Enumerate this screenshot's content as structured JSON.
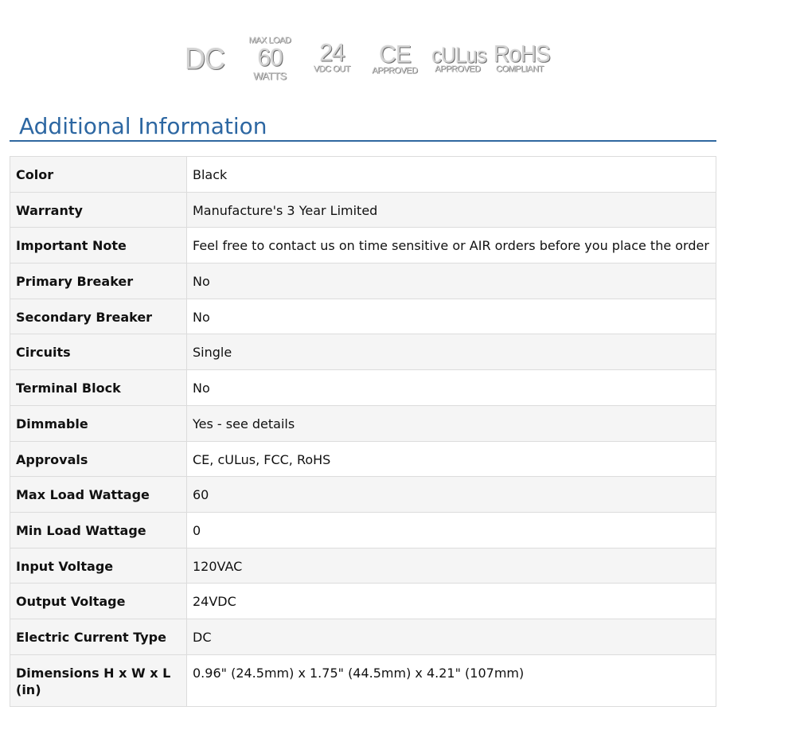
{
  "badges": {
    "dc": "DC",
    "max_load_top": "MAX LOAD",
    "max_load_value": "60",
    "max_load_unit": "WATTS",
    "vdc_value": "24",
    "vdc_label": "VDC OUT",
    "ce": "CE",
    "ce_label": "APPROVED",
    "culus": "cULus",
    "culus_label": "APPROVED",
    "rohs": "RoHS",
    "rohs_label": "COMPLIANT"
  },
  "section": {
    "title": "Additional Information"
  },
  "specs": [
    {
      "label": "Color",
      "value": "Black"
    },
    {
      "label": "Warranty",
      "value": "Manufacture's 3 Year Limited"
    },
    {
      "label": "Important Note",
      "value": "Feel free to contact us on time sensitive or AIR orders before you place the order"
    },
    {
      "label": "Primary Breaker",
      "value": "No"
    },
    {
      "label": "Secondary Breaker",
      "value": "No"
    },
    {
      "label": "Circuits",
      "value": "Single"
    },
    {
      "label": "Terminal Block",
      "value": "No"
    },
    {
      "label": "Dimmable",
      "value": "Yes - see details"
    },
    {
      "label": "Approvals",
      "value": "CE, cULus, FCC, RoHS"
    },
    {
      "label": "Max Load Wattage",
      "value": "60"
    },
    {
      "label": "Min Load Wattage",
      "value": "0"
    },
    {
      "label": "Input Voltage",
      "value": "120VAC"
    },
    {
      "label": "Output Voltage",
      "value": "24VDC"
    },
    {
      "label": "Electric Current Type",
      "value": "DC"
    },
    {
      "label": "Dimensions H x W x L (in)",
      "value": "0.96\" (24.5mm) x 1.75\" (44.5mm) x 4.21\" (107mm)"
    }
  ],
  "colors": {
    "title_blue": "#2d67a2",
    "rule_blue": "#2f68a0",
    "row_alt": "#f5f5f5",
    "border": "#dcdcdc"
  }
}
